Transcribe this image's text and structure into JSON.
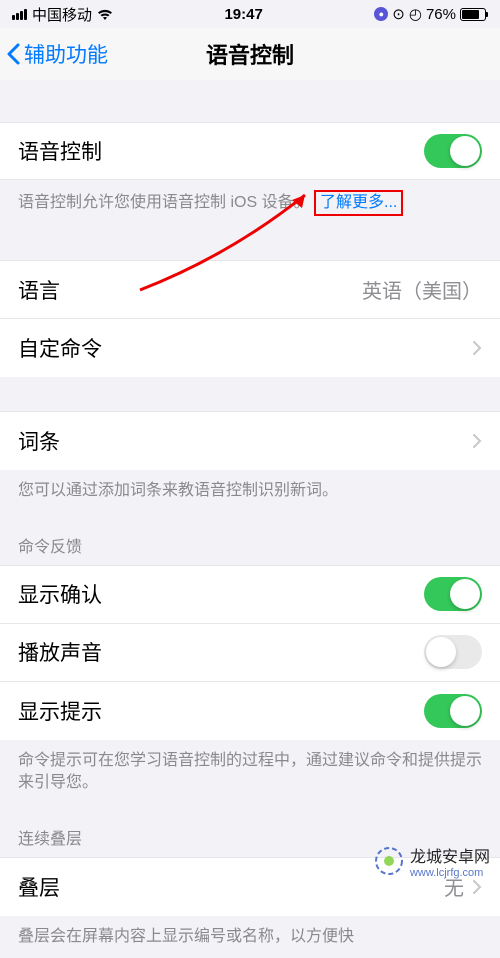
{
  "status": {
    "carrier": "中国移动",
    "time": "19:47",
    "battery_pct": "76%"
  },
  "nav": {
    "back": "辅助功能",
    "title": "语音控制"
  },
  "sections": {
    "main": {
      "voice_control": "语音控制",
      "voice_control_on": true,
      "desc": "语音控制允许您使用语音控制 iOS 设备。",
      "learn_more": "了解更多..."
    },
    "lang": {
      "label": "语言",
      "value": "英语（美国）",
      "custom": "自定命令"
    },
    "vocab": {
      "label": "词条",
      "desc": "您可以通过添加词条来教语音控制识别新词。"
    },
    "feedback": {
      "header": "命令反馈",
      "confirm": "显示确认",
      "confirm_on": true,
      "sound": "播放声音",
      "sound_on": false,
      "hint": "显示提示",
      "hint_on": true,
      "desc": "命令提示可在您学习语音控制的过程中，通过建议命令和提供提示来引导您。"
    },
    "overlay": {
      "header": "连续叠层",
      "label": "叠层",
      "value": "无",
      "desc": "叠层会在屏幕内容上显示编号或名称，以方便快"
    }
  },
  "watermark": {
    "name": "龙城安卓网",
    "url": "www.lcjrfg.com"
  }
}
